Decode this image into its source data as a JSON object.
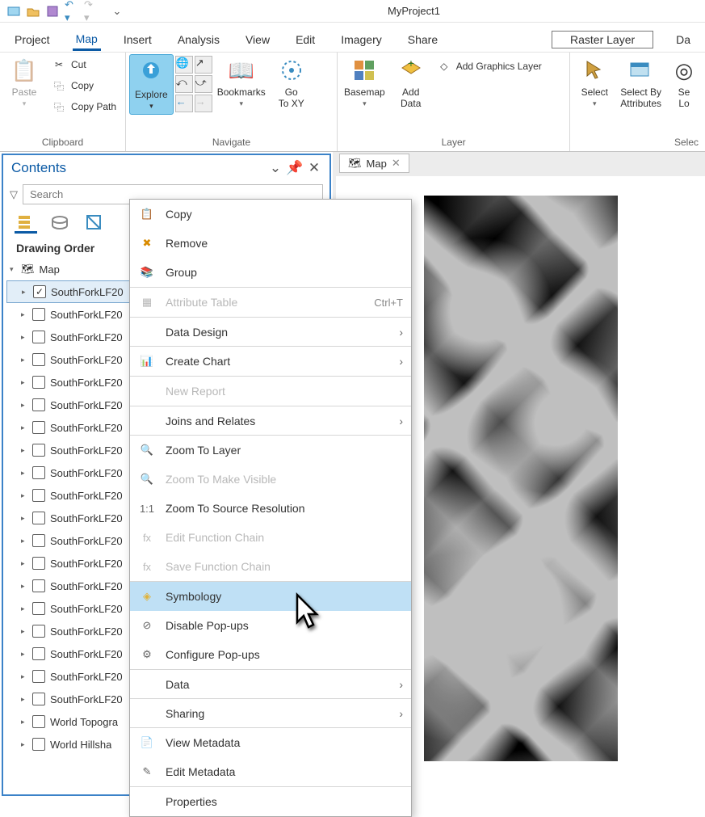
{
  "titlebar": {
    "app_title": "MyProject1"
  },
  "menubar": {
    "tabs": [
      "Project",
      "Map",
      "Insert",
      "Analysis",
      "View",
      "Edit",
      "Imagery",
      "Share"
    ],
    "active_index": 1,
    "context_tab": "Raster Layer",
    "context_tab2": "Da"
  },
  "ribbon": {
    "clipboard": {
      "label": "Clipboard",
      "paste": "Paste",
      "cut": "Cut",
      "copy": "Copy",
      "copy_path": "Copy Path"
    },
    "navigate": {
      "label": "Navigate",
      "explore": "Explore",
      "bookmarks": "Bookmarks",
      "goto": "Go\nTo XY"
    },
    "layer": {
      "label": "Layer",
      "basemap": "Basemap",
      "add_data": "Add\nData",
      "add_graphics": "Add Graphics Layer"
    },
    "selection": {
      "label": "Selec",
      "select": "Select",
      "select_by_attr": "Select By\nAttributes",
      "select_by_loc": "Se\nLo"
    }
  },
  "contents": {
    "title": "Contents",
    "search_placeholder": "Search",
    "section": "Drawing Order",
    "map_node": "Map",
    "layers": [
      {
        "checked": true,
        "name": "SouthForkLF20"
      },
      {
        "checked": false,
        "name": "SouthForkLF20"
      },
      {
        "checked": false,
        "name": "SouthForkLF20"
      },
      {
        "checked": false,
        "name": "SouthForkLF20"
      },
      {
        "checked": false,
        "name": "SouthForkLF20"
      },
      {
        "checked": false,
        "name": "SouthForkLF20"
      },
      {
        "checked": false,
        "name": "SouthForkLF20"
      },
      {
        "checked": false,
        "name": "SouthForkLF20"
      },
      {
        "checked": false,
        "name": "SouthForkLF20"
      },
      {
        "checked": false,
        "name": "SouthForkLF20"
      },
      {
        "checked": false,
        "name": "SouthForkLF20"
      },
      {
        "checked": false,
        "name": "SouthForkLF20"
      },
      {
        "checked": false,
        "name": "SouthForkLF20"
      },
      {
        "checked": false,
        "name": "SouthForkLF20"
      },
      {
        "checked": false,
        "name": "SouthForkLF20"
      },
      {
        "checked": false,
        "name": "SouthForkLF20"
      },
      {
        "checked": false,
        "name": "SouthForkLF20"
      },
      {
        "checked": false,
        "name": "SouthForkLF20"
      },
      {
        "checked": false,
        "name": "SouthForkLF20"
      },
      {
        "checked": false,
        "name": "World Topogra"
      },
      {
        "checked": false,
        "name": "World Hillsha"
      }
    ]
  },
  "maptab": {
    "title": "Map"
  },
  "ctx": {
    "items": [
      {
        "icon": "📋",
        "label": "Copy",
        "type": "item"
      },
      {
        "icon": "✖",
        "label": "Remove",
        "type": "item",
        "icon_color": "#d98b00"
      },
      {
        "icon": "📚",
        "label": "Group",
        "type": "item",
        "icon_color": "#e0b23a"
      },
      {
        "type": "sep"
      },
      {
        "icon": "▦",
        "label": "Attribute Table",
        "type": "item",
        "disabled": true,
        "shortcut": "Ctrl+T"
      },
      {
        "label": "Data Design",
        "type": "cat",
        "arrow": true
      },
      {
        "type": "sep"
      },
      {
        "icon": "📊",
        "label": "Create Chart",
        "type": "item",
        "arrow": true
      },
      {
        "type": "sep"
      },
      {
        "icon": "",
        "label": "New Report",
        "type": "item",
        "disabled": true
      },
      {
        "label": "Joins and Relates",
        "type": "cat",
        "arrow": true
      },
      {
        "type": "sep"
      },
      {
        "icon": "🔍",
        "label": "Zoom To Layer",
        "type": "item",
        "icon_color": "#e0b23a"
      },
      {
        "icon": "🔍",
        "label": "Zoom To Make Visible",
        "type": "item",
        "disabled": true
      },
      {
        "icon": "1:1",
        "label": "Zoom To Source Resolution",
        "type": "item"
      },
      {
        "icon": "fx",
        "label": "Edit Function Chain",
        "type": "item",
        "disabled": true
      },
      {
        "icon": "fx",
        "label": "Save Function Chain",
        "type": "item",
        "disabled": true
      },
      {
        "type": "sep"
      },
      {
        "icon": "◈",
        "label": "Symbology",
        "type": "item",
        "highlight": true,
        "icon_color": "#e0b23a"
      },
      {
        "icon": "⊘",
        "label": "Disable Pop-ups",
        "type": "item"
      },
      {
        "icon": "⚙",
        "label": "Configure Pop-ups",
        "type": "item"
      },
      {
        "label": "Data",
        "type": "cat",
        "arrow": true
      },
      {
        "label": "Sharing",
        "type": "cat",
        "arrow": true
      },
      {
        "type": "sep"
      },
      {
        "icon": "📄",
        "label": "View Metadata",
        "type": "item"
      },
      {
        "icon": "✎",
        "label": "Edit Metadata",
        "type": "item"
      },
      {
        "type": "sep"
      },
      {
        "icon": "",
        "label": "Properties",
        "type": "item"
      }
    ]
  }
}
